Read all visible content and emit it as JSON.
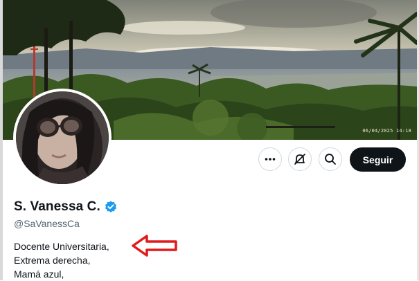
{
  "banner": {
    "timestamp": "06/04/2025 14:18",
    "colors": {
      "sky": "#c9c4ad",
      "mountain": "#6f7a82",
      "foliage": "#2f4a1f"
    }
  },
  "profile": {
    "display_name": "S. Vanessa C.",
    "handle": "@SaVanessCa",
    "verified": true,
    "bio_lines": [
      "Docente Universitaria,",
      "Extrema derecha,",
      "Mamá azul,"
    ],
    "avatar": "avatar-photo"
  },
  "actions": {
    "more_icon": "more-horizontal-icon",
    "nofollow_icon": "block-notifications-icon",
    "search_icon": "search-icon",
    "follow_label": "Seguir"
  },
  "annotation": {
    "icon": "red-arrow-left-icon",
    "color": "#e01b1b"
  },
  "colors": {
    "accent": "#1d9bf0",
    "primary_text": "#0f1419",
    "secondary_text": "#536471",
    "button_dark": "#0f1419"
  }
}
